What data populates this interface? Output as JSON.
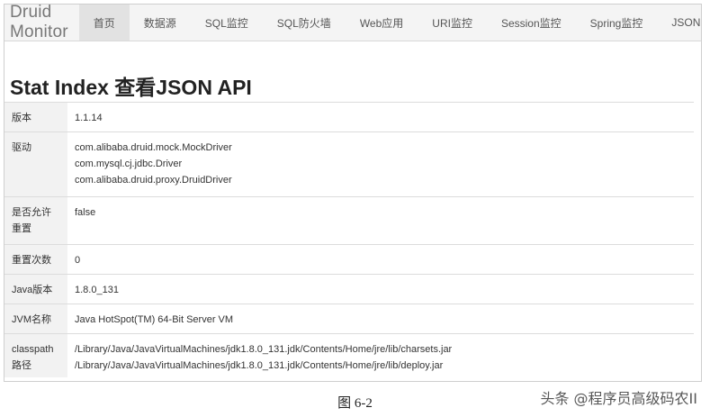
{
  "navbar": {
    "brand": "Druid Monitor",
    "items": [
      {
        "label": "首页",
        "active": true
      },
      {
        "label": "数据源"
      },
      {
        "label": "SQL监控"
      },
      {
        "label": "SQL防火墙"
      },
      {
        "label": "Web应用"
      },
      {
        "label": "URI监控"
      },
      {
        "label": "Session监控"
      },
      {
        "label": "Spring监控"
      },
      {
        "label": "JSON API"
      }
    ]
  },
  "main": {
    "title": "Stat Index 查看JSON API",
    "rows": {
      "version": {
        "key": "版本",
        "values": [
          "1.1.14"
        ]
      },
      "driver": {
        "key": "驱动",
        "values": [
          "com.alibaba.druid.mock.MockDriver",
          "com.mysql.cj.jdbc.Driver",
          "com.alibaba.druid.proxy.DruidDriver"
        ]
      },
      "reset_enable": {
        "key_lines": [
          "是否允许",
          "重置"
        ],
        "values": [
          "false"
        ]
      },
      "reset_count": {
        "key": "重置次数",
        "values": [
          "0"
        ]
      },
      "java_version": {
        "key": "Java版本",
        "values": [
          "1.8.0_131"
        ]
      },
      "jvm_name": {
        "key": "JVM名称",
        "values": [
          "Java HotSpot(TM) 64-Bit Server VM"
        ]
      },
      "classpath": {
        "key_lines": [
          "classpath",
          "路径"
        ],
        "values": [
          "/Library/Java/JavaVirtualMachines/jdk1.8.0_131.jdk/Contents/Home/jre/lib/charsets.jar",
          "/Library/Java/JavaVirtualMachines/jdk1.8.0_131.jdk/Contents/Home/jre/lib/deploy.jar"
        ]
      }
    }
  },
  "caption": "图 6-2",
  "watermark": "头条 @程序员高级码农II"
}
